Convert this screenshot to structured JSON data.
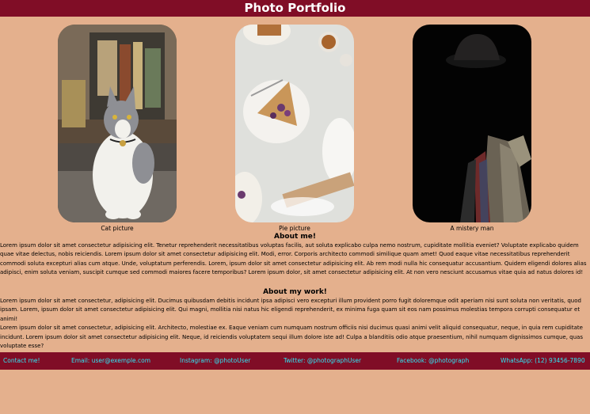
{
  "header": {
    "title": "Photo Portfolio"
  },
  "gallery": [
    {
      "icon": "cat-photo",
      "caption": "Cat picture"
    },
    {
      "icon": "pie-photo",
      "caption": "Pie picture"
    },
    {
      "icon": "mystery-man-photo",
      "caption": "A mistery man"
    }
  ],
  "about_me": {
    "title": "About me!",
    "text": "Lorem ipsum dolor sit amet consectetur adipisicing elit. Tenetur reprehenderit necessitatibus voluptas facilis, aut soluta explicabo culpa nemo nostrum, cupiditate mollitia eveniet? Voluptate explicabo quidem quae vitae delectus, nobis reiciendis. Lorem ipsum dolor sit amet consectetur adipisicing elit. Modi, error. Corporis architecto commodi similique quam amet! Quod eaque vitae necessitatibus reprehenderit commodi soluta excepturi alias cum atque. Unde, voluptatum perferendis. Lorem, ipsum dolor sit amet consectetur adipisicing elit. Ab rem modi nulla hic consequatur accusantium. Quidem eligendi dolores alias adipisci, enim soluta veniam, suscipit cumque sed commodi maiores facere temporibus? Lorem ipsum dolor, sit amet consectetur adipisicing elit. At non vero nesciunt accusamus vitae quia ad natus dolores id!"
  },
  "about_work": {
    "title": "About my work!",
    "paragraphs": [
      "Lorem ipsum dolor sit amet consectetur, adipisicing elit. Ducimus quibusdam debitis incidunt ipsa adipisci vero excepturi illum provident porro fugit doloremque odit aperiam nisi sunt soluta non veritatis, quod ipsam. Lorem, ipsum dolor sit amet consectetur adipisicing elit. Qui magni, mollitia nisi natus hic eligendi reprehenderit, ex minima fuga quam sit eos nam possimus molestias tempora corrupti consequatur et animi!",
      "Lorem ipsum dolor sit amet consectetur, adipisicing elit. Architecto, molestiae ex. Eaque veniam cum numquam nostrum officiis nisi ducimus quasi animi velit aliquid consequatur, neque, in quia rem cupiditate incidunt. Lorem ipsum dolor sit amet consectetur adipisicing elit. Neque, id reiciendis voluptatem sequi illum dolore iste ad! Culpa a blanditiis odio atque praesentium, nihil numquam dignissimos cumque, quas voluptate esse?"
    ]
  },
  "footer": {
    "contact": "Contact me!",
    "email": "Email: user@exemple.com",
    "instagram": "Instagram: @photoUser",
    "twitter": "Twitter: @photographUser",
    "facebook": "Facebook: @photograph",
    "whatsapp": "WhatsApp: (12) 93456-7890"
  },
  "colors": {
    "background": "#e4b08d",
    "header_bg": "#800d26",
    "footer_link": "#2fe6f4"
  }
}
